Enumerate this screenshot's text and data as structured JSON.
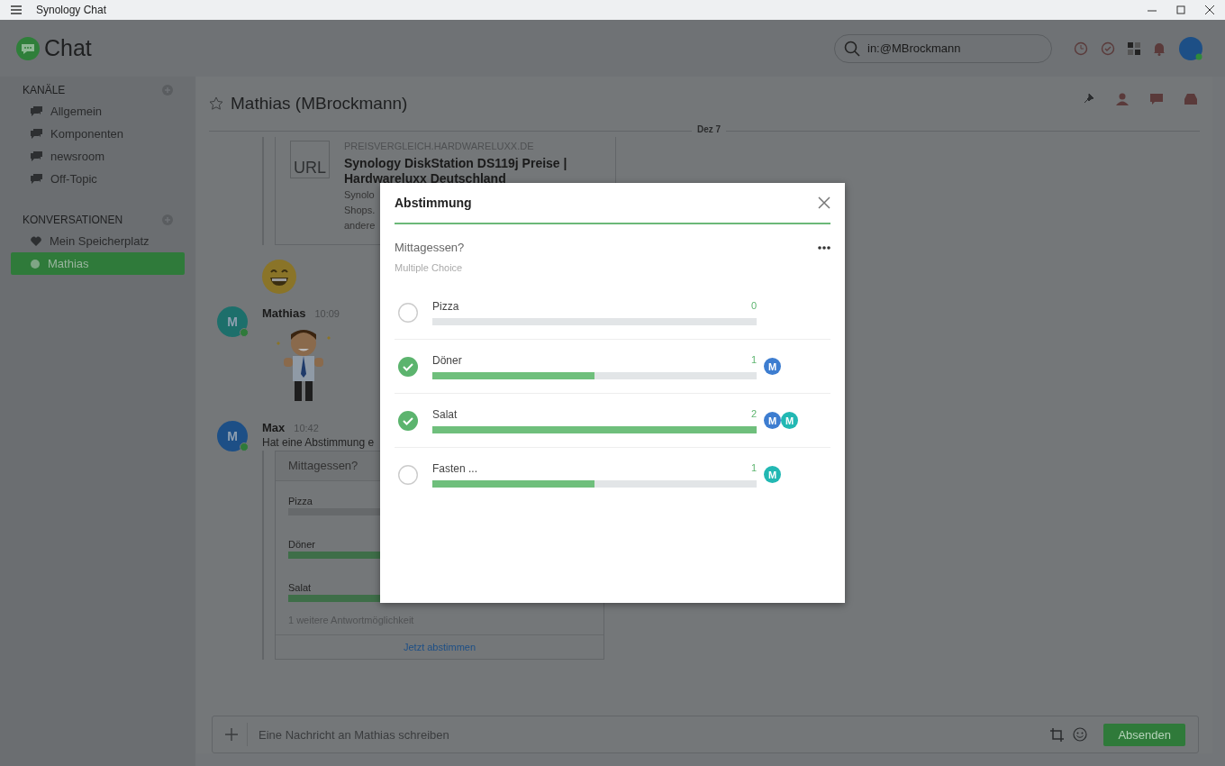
{
  "window": {
    "title": "Synology Chat"
  },
  "app": {
    "logo": "Chat",
    "search": {
      "value": "in:@MBrockmann"
    }
  },
  "sidebar": {
    "sections": [
      {
        "title": "KANÄLE",
        "items": [
          {
            "label": "Allgemein",
            "kind": "channel",
            "selected": false
          },
          {
            "label": "Komponenten",
            "kind": "channel",
            "selected": false
          },
          {
            "label": "newsroom",
            "kind": "channel",
            "selected": false
          },
          {
            "label": "Off-Topic",
            "kind": "channel",
            "selected": false
          }
        ]
      },
      {
        "title": "KONVERSATIONEN",
        "items": [
          {
            "label": "Mein Speicherplatz",
            "kind": "favorite",
            "selected": false
          },
          {
            "label": "Mathias",
            "kind": "person",
            "selected": true
          }
        ]
      }
    ]
  },
  "chat": {
    "title": "Mathias (MBrockmann)",
    "starred": false,
    "date": "Dez 7",
    "link_preview": {
      "domain": "PREISVERGLEICH.HARDWARELUXX.DE",
      "thumb": "URL",
      "title": "Synology DiskStation DS119j Preise | Hardwareluxx Deutschland",
      "description": [
        "Synolo",
        "Shops.",
        "andere"
      ]
    },
    "messages": [
      {
        "kind": "sticker",
        "author": "Mathias",
        "initial": "M",
        "color": "#1d6f6b",
        "time": "10:09"
      },
      {
        "kind": "poll",
        "author": "Max",
        "initial": "M",
        "color": "#1d4f86",
        "time": "10:42",
        "text": "Hat eine Abstimmung e",
        "poll": {
          "question": "Mittagessen?",
          "options": [
            {
              "label": "Pizza",
              "level": 0
            },
            {
              "label": "Döner",
              "level": 0.5
            },
            {
              "label": "Salat",
              "level": 1
            }
          ],
          "more": "1 weitere Antwortmöglichkeit",
          "action": "Jetzt abstimmen"
        }
      }
    ]
  },
  "composer": {
    "placeholder": "Eine Nachricht an Mathias schreiben",
    "send": "Absenden"
  },
  "modal": {
    "title": "Abstimmung",
    "question": "Mittagessen?",
    "type": "Multiple Choice",
    "options": [
      {
        "label": "Pizza",
        "count": "0",
        "level": 0,
        "checked": false
      },
      {
        "label": "Döner",
        "count": "1",
        "level": 0.5,
        "checked": true,
        "voters": [
          {
            "initial": "M",
            "color": "#3d7dd0"
          }
        ]
      },
      {
        "label": "Salat",
        "count": "2",
        "level": 1,
        "checked": true,
        "voters": [
          {
            "initial": "M",
            "color": "#3d7dd0"
          },
          {
            "initial": "M",
            "color": "#22b8b3"
          }
        ]
      },
      {
        "label": "Fasten ...",
        "count": "1",
        "level": 0.5,
        "checked": false,
        "voters": [
          {
            "initial": "M",
            "color": "#22b8b3"
          }
        ]
      }
    ]
  }
}
